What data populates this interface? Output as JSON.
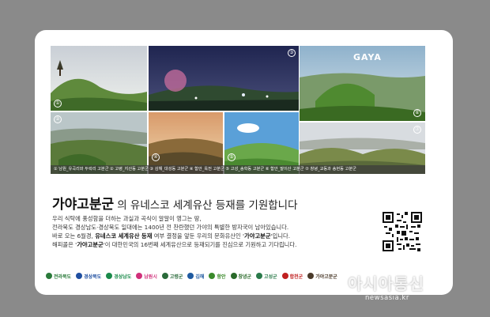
{
  "photos": {
    "logo": "GAYA",
    "numbers": [
      "①",
      "②",
      "③",
      "④",
      "⑤",
      "⑥",
      "⑦"
    ],
    "caption": "① 남원_유곡리와 두락리 고분군 ② 고령_지산동 고분군 ③ 김해_대성동 고분군 ④ 함안_옥전 고분군 ⑤ 고성_송학동 고분군 ⑥ 함안_말이산 고분군 ⑦ 창녕_교동과 송현동 고분군"
  },
  "headline": {
    "brand": "가야고분군",
    "rest": "의 유네스코 세계유산 등재를 기원합니다"
  },
  "body": {
    "line1": "우리 식탁에 풍성함을 더하는 과실과 곡식이 알알이 영그는 땅,",
    "line2": "전라북도 경상남도·경상북도 일대에는 1400년 전 찬란했던 가야의 특별한 방자국이 남아있습니다.",
    "line3_pre": "바로 오는 6월경, ",
    "line3_bold": "유네스코 세계유산 등재",
    "line3_mid": " 여부 결정을 앞둔 우리의 문화유산인 '",
    "line3_brand": "가야고분군",
    "line3_post": "'입니다.",
    "line4_pre": "해피콜은 '",
    "line4_brand": "가야고분군",
    "line4_post": "'이 대한민국의 16번째 세계유산으로 등재되기를 진심으로 기원하고 기다립니다."
  },
  "logos": [
    {
      "name": "전라북도",
      "color": "#2a7a3a"
    },
    {
      "name": "경상북도",
      "color": "#1f4fa0"
    },
    {
      "name": "경상남도",
      "color": "#1a8a4a"
    },
    {
      "name": "남원시",
      "color": "#d0307a"
    },
    {
      "name": "고령군",
      "color": "#2a6a3a"
    },
    {
      "name": "김해",
      "color": "#1f5aa0"
    },
    {
      "name": "함안",
      "color": "#3a8a2a"
    },
    {
      "name": "창녕군",
      "color": "#2a6a2a"
    },
    {
      "name": "고성군",
      "color": "#2a7a4a"
    },
    {
      "name": "합천군",
      "color": "#c02020"
    },
    {
      "name": "가야고분군",
      "color": "#4a3a2a"
    }
  ],
  "watermark": {
    "text": "아시아통신",
    "url": "newsasia.kr"
  }
}
